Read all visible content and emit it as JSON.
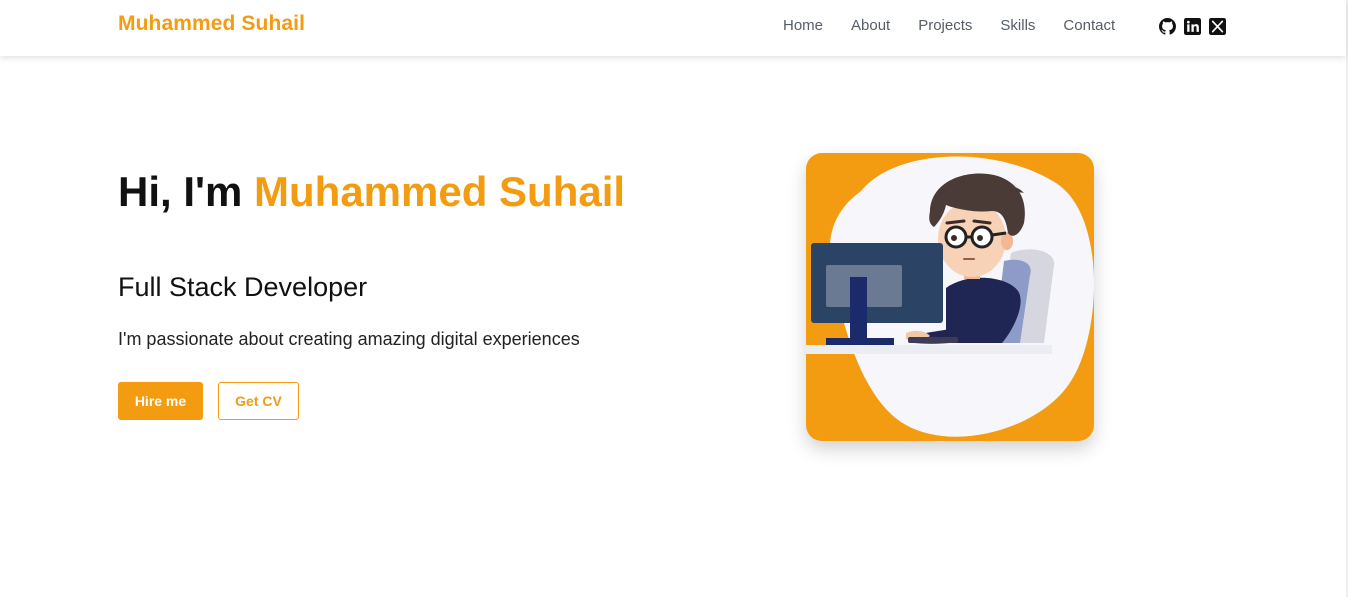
{
  "header": {
    "brand": "Muhammed Suhail",
    "nav": [
      "Home",
      "About",
      "Projects",
      "Skills",
      "Contact"
    ],
    "socials": [
      "github-icon",
      "linkedin-icon",
      "x-icon"
    ]
  },
  "hero": {
    "greeting": "Hi, I'm",
    "name": "Muhammed Suhail",
    "role": "Full Stack Developer",
    "description": "I'm passionate about creating amazing digital experiences",
    "primary_button": "Hire me",
    "secondary_button": "Get CV"
  },
  "colors": {
    "accent": "#f39c12",
    "text": "#111111",
    "nav_text": "#555d66"
  }
}
